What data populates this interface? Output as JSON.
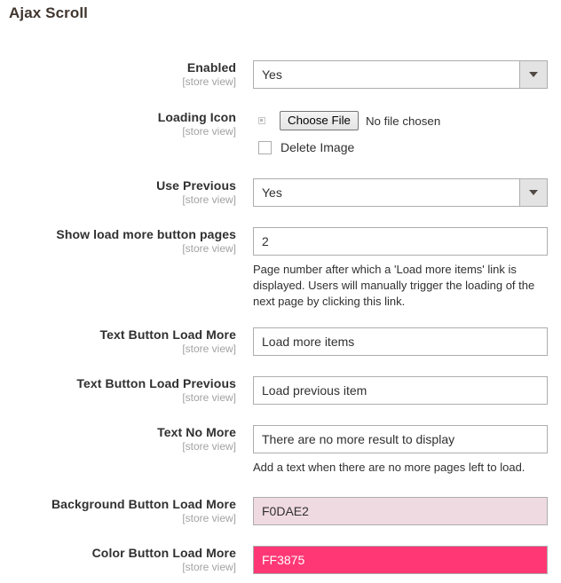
{
  "page": {
    "title": "Ajax Scroll",
    "scope_note": "[store view]"
  },
  "fields": {
    "enabled": {
      "label": "Enabled",
      "scope": "[store view]",
      "value": "Yes",
      "arrow_icon": "chevron-down-icon"
    },
    "loading_icon": {
      "label": "Loading Icon",
      "scope": "[store view]",
      "image_placeholder_icon": "broken-image-icon",
      "choose_file_label": "Choose File",
      "no_file_text": "No file chosen",
      "delete_image_label": "Delete Image",
      "delete_image_checked": "false"
    },
    "use_previous": {
      "label": "Use Previous",
      "scope": "[store view]",
      "value": "Yes",
      "arrow_icon": "chevron-down-icon"
    },
    "show_load_more_button_pages": {
      "label": "Show load more button pages",
      "scope": "[store view]",
      "value": "2",
      "note": "Page number after which a 'Load more items' link is displayed. Users will manually trigger the loading of the next page by clicking this link."
    },
    "text_button_load_more": {
      "label": "Text Button Load More",
      "scope": "[store view]",
      "value": "Load more items"
    },
    "text_button_load_previous": {
      "label": "Text Button Load Previous",
      "scope": "[store view]",
      "value": "Load previous item"
    },
    "text_no_more": {
      "label": "Text No More",
      "scope": "[store view]",
      "value": "There are no more result to display",
      "note": "Add a text when there are no more pages left to load."
    },
    "background_button_load_more": {
      "label": "Background Button Load More",
      "scope": "[store view]",
      "value": "F0DAE2",
      "swatch_hex": "#F0DAE2",
      "text_hex": "#303030"
    },
    "color_button_load_more": {
      "label": "Color Button Load More",
      "scope": "[store view]",
      "value": "FF3875",
      "swatch_hex": "#FF3875",
      "text_hex": "#FFFFFF"
    }
  }
}
